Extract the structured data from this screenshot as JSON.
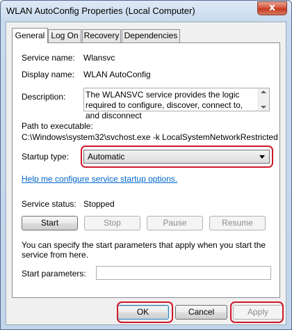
{
  "window": {
    "title": "WLAN AutoConfig Properties (Local Computer)",
    "close_glyph": "x"
  },
  "tabs": [
    {
      "label": "General",
      "active": true
    },
    {
      "label": "Log On",
      "active": false
    },
    {
      "label": "Recovery",
      "active": false
    },
    {
      "label": "Dependencies",
      "active": false
    }
  ],
  "general": {
    "service_name_label": "Service name:",
    "service_name_value": "Wlansvc",
    "display_name_label": "Display name:",
    "display_name_value": "WLAN AutoConfig",
    "description_label": "Description:",
    "description_text": "The WLANSVC service provides the logic required to configure, discover, connect to, and disconnect",
    "path_label": "Path to executable:",
    "path_value": "C:\\Windows\\system32\\svchost.exe -k LocalSystemNetworkRestricted",
    "startup_type_label": "Startup type:",
    "startup_type_value": "Automatic",
    "help_link": "Help me configure service startup options.",
    "service_status_label": "Service status:",
    "service_status_value": "Stopped",
    "start_button": "Start",
    "stop_button": "Stop",
    "pause_button": "Pause",
    "resume_button": "Resume",
    "params_note": "You can specify the start parameters that apply when you start the service from here.",
    "start_params_label": "Start parameters:",
    "start_params_value": ""
  },
  "footer": {
    "ok_button": "OK",
    "cancel_button": "Cancel",
    "apply_button": "Apply"
  },
  "colors": {
    "highlight": "#d0182a",
    "link": "#0066cc",
    "close_button": "#c43a22"
  }
}
